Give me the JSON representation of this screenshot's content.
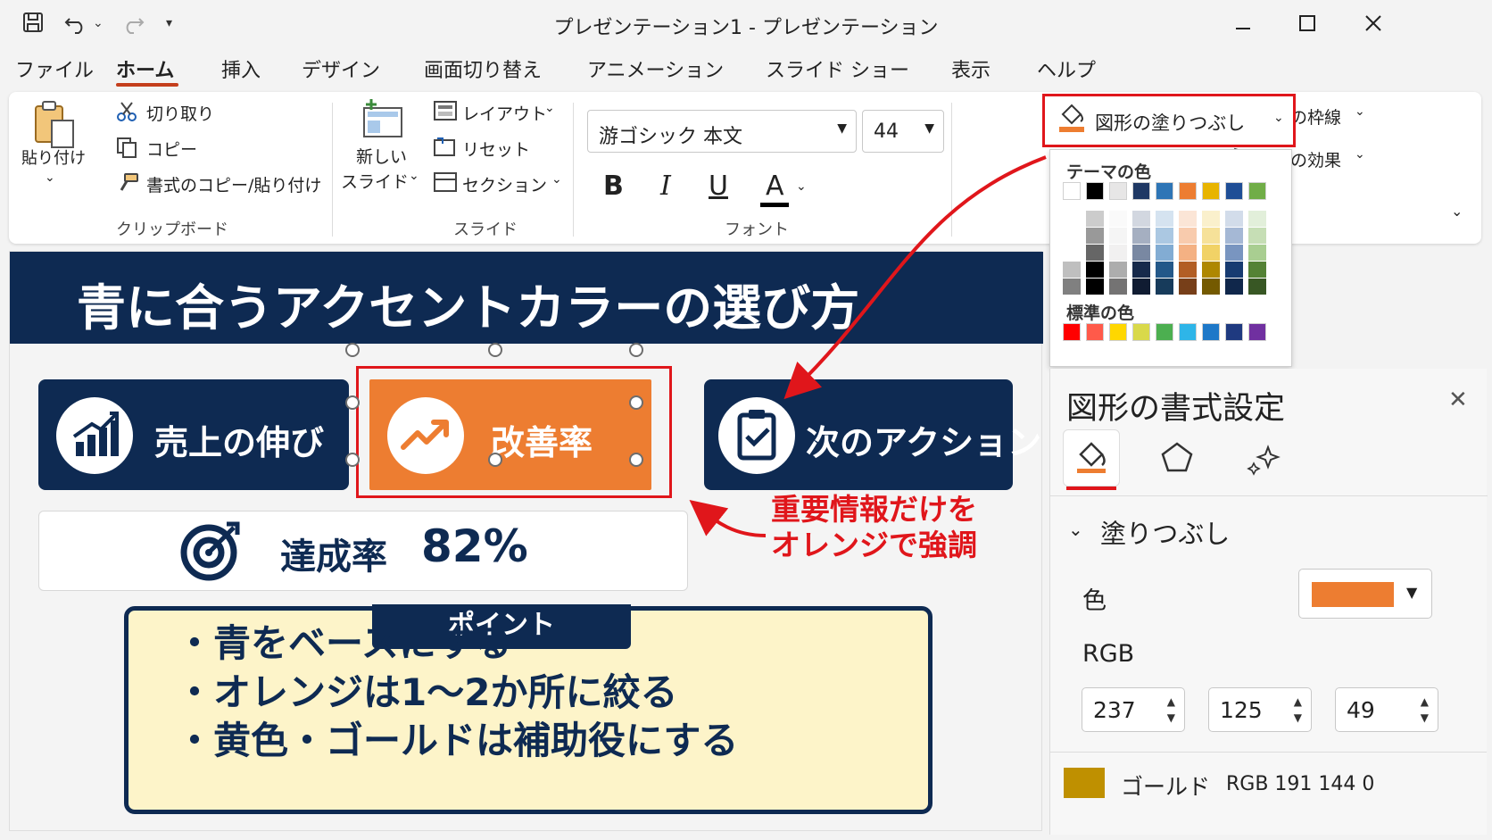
{
  "window": {
    "title": "プレゼンテーション1 - プレゼンテーション"
  },
  "menu": {
    "items": [
      "ファイル",
      "ホーム",
      "挿入",
      "デザイン",
      "画面切り替え",
      "アニメーション",
      "スライド ショー",
      "表示",
      "ヘルプ"
    ],
    "active_index": 1
  },
  "ribbon": {
    "clipboard": {
      "paste": "貼り付け",
      "cut": "切り取り",
      "copy": "コピー",
      "format_painter": "書式のコピー/貼り付け",
      "label": "クリップボード"
    },
    "slides": {
      "new_slide_line1": "新しい",
      "new_slide_line2": "スライド",
      "layout": "レイアウト",
      "reset": "リセット",
      "section": "セクション",
      "label": "スライド"
    },
    "font": {
      "name": "游ゴシック 本文",
      "size": "44",
      "bold": "B",
      "italic": "I",
      "underline": "U",
      "color": "A",
      "label": "フォント"
    },
    "drawing": {
      "fill": "図形の塗りつぶし",
      "outline": "図形の枠線",
      "effects": "図形の効果"
    }
  },
  "fill_dropdown": {
    "theme_label": "テーマの色",
    "standard_label": "標準の色",
    "theme_colors": [
      "#ffffff",
      "#000000",
      "#e7e6e6",
      "#1f3864",
      "#2e75b6",
      "#ed7d31",
      "#e8b400",
      "#1f4e96",
      "#70ad47"
    ],
    "standard_colors": [
      "#ff0000",
      "#ff5a4a",
      "#ffd700",
      "#d9d94a",
      "#4caf50",
      "#2eb5e8",
      "#1e78c8",
      "#1f3a80",
      "#7030a0"
    ]
  },
  "slide": {
    "title": "青に合うアクセントカラーの選び方",
    "cards": [
      "売上の伸び",
      "改善率",
      "次のアクション"
    ],
    "metric_label": "達成率",
    "metric_value": "82%",
    "callout_line1": "重要情報だけを",
    "callout_line2": "オレンジで強調",
    "point_label": "ポイント",
    "points": [
      "・青をベースにする",
      "・オレンジは1～2か所に絞る",
      "・黄色・ゴールドは補助役にする"
    ],
    "colors": {
      "navy": "#0e2a52",
      "orange": "#ed7d31",
      "highlight": "#e0161b",
      "note_bg": "#fdf4c9"
    }
  },
  "format_pane": {
    "title": "図形の書式設定",
    "section": "塗りつぶし",
    "color_label": "色",
    "color_value": "#ed7d31",
    "rgb_label": "RGB",
    "r": "237",
    "g": "125",
    "b": "49",
    "gold_name": "ゴールド",
    "gold_rgb": "RGB 191 144 0",
    "gold_color": "#bf9000"
  }
}
